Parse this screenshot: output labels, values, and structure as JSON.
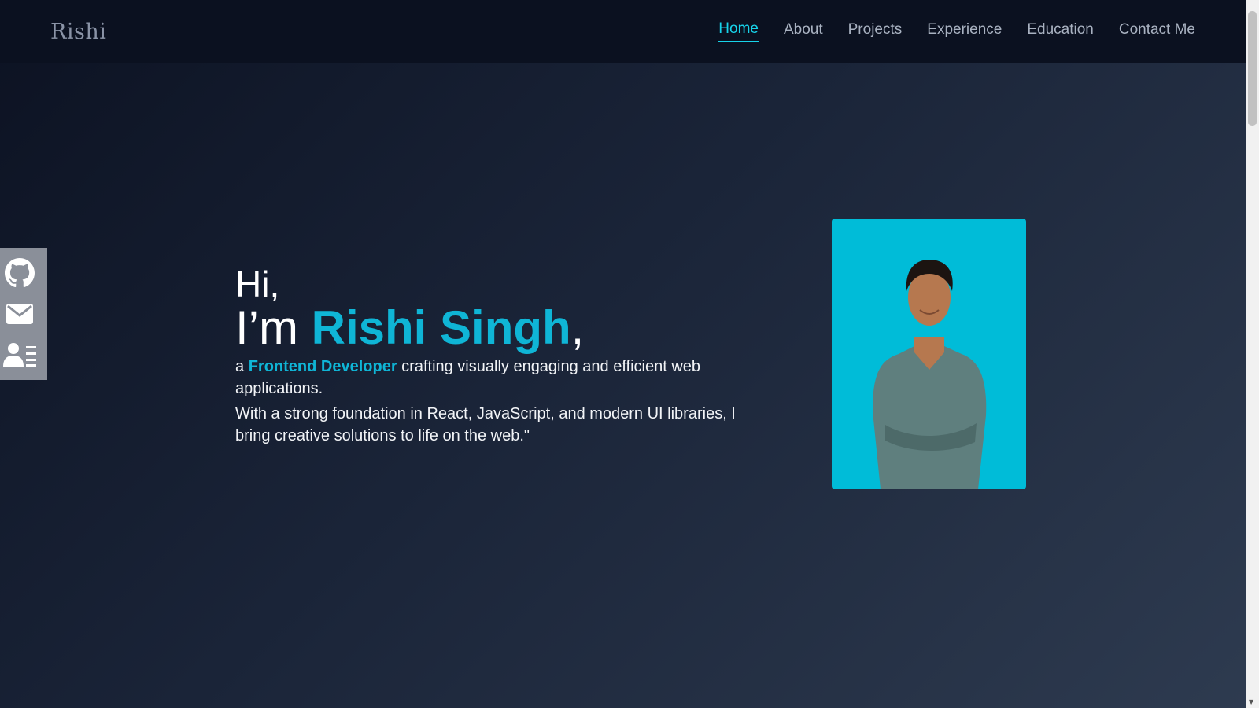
{
  "brand": {
    "logo_text": "Rishi"
  },
  "nav": {
    "items": [
      {
        "label": "Home",
        "active": true
      },
      {
        "label": "About"
      },
      {
        "label": "Projects"
      },
      {
        "label": "Experience"
      },
      {
        "label": "Education"
      },
      {
        "label": "Contact Me"
      }
    ]
  },
  "social": {
    "icons": [
      "github-icon",
      "mail-icon",
      "contact-card-icon"
    ]
  },
  "hero": {
    "greeting": "Hi,",
    "intro_prefix": "I’m ",
    "name": "Rishi Singh",
    "name_suffix": ",",
    "desc_prefix": "a ",
    "role": "Frontend Developer",
    "desc_line1_rest": " crafting visually engaging and efficient web applications.",
    "desc_line2": "With a strong foundation in React, JavaScript, and modern UI libraries, I bring creative solutions to life on the web.\""
  },
  "colors": {
    "accent": "#0fb5d6",
    "nav_bg": "#0b1120",
    "photo_bg": "#00bcd8"
  }
}
